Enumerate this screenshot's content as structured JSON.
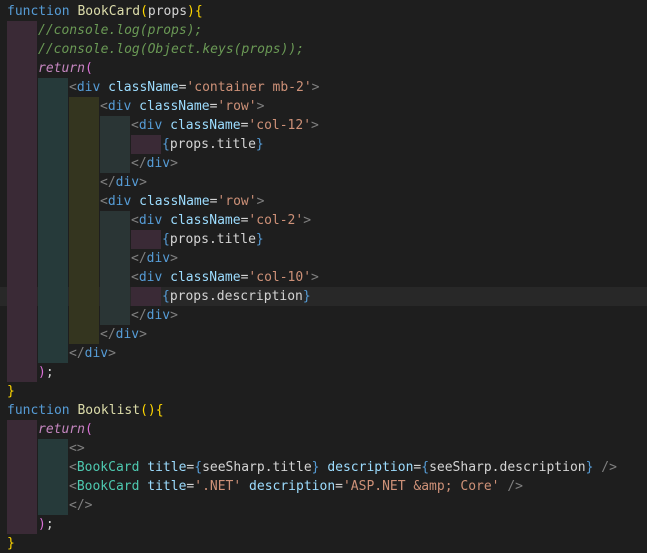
{
  "editor": {
    "language": "javascript-jsx",
    "lines": [
      {
        "indent": 0,
        "tokens": [
          [
            "kw",
            "function"
          ],
          [
            "txt",
            " "
          ],
          [
            "fn",
            "BookCard"
          ],
          [
            "br",
            "("
          ],
          [
            "txt",
            "props"
          ],
          [
            "br",
            "){"
          ]
        ]
      },
      {
        "indent": 1,
        "tokens": [
          [
            "com",
            "//console.log(props);"
          ]
        ]
      },
      {
        "indent": 1,
        "tokens": [
          [
            "com",
            "//console.log(Object.keys(props));"
          ]
        ]
      },
      {
        "indent": 1,
        "tokens": [
          [
            "ctl",
            "return"
          ],
          [
            "br2",
            "("
          ]
        ]
      },
      {
        "indent": 2,
        "tokens": [
          [
            "pun",
            "<"
          ],
          [
            "tag",
            "div"
          ],
          [
            "txt",
            " "
          ],
          [
            "attr",
            "className"
          ],
          [
            "txt",
            "="
          ],
          [
            "str",
            "'container mb-2'"
          ],
          [
            "pun",
            ">"
          ]
        ]
      },
      {
        "indent": 3,
        "tokens": [
          [
            "pun",
            "<"
          ],
          [
            "tag",
            "div"
          ],
          [
            "txt",
            " "
          ],
          [
            "attr",
            "className"
          ],
          [
            "txt",
            "="
          ],
          [
            "str",
            "'row'"
          ],
          [
            "pun",
            ">"
          ]
        ]
      },
      {
        "indent": 4,
        "tokens": [
          [
            "pun",
            "<"
          ],
          [
            "tag",
            "div"
          ],
          [
            "txt",
            " "
          ],
          [
            "attr",
            "className"
          ],
          [
            "txt",
            "="
          ],
          [
            "str",
            "'col-12'"
          ],
          [
            "pun",
            ">"
          ]
        ]
      },
      {
        "indent": 5,
        "tokens": [
          [
            "kw",
            "{"
          ],
          [
            "txt",
            "props.title"
          ],
          [
            "kw",
            "}"
          ]
        ]
      },
      {
        "indent": 4,
        "tokens": [
          [
            "pun",
            "</"
          ],
          [
            "tag",
            "div"
          ],
          [
            "pun",
            ">"
          ]
        ]
      },
      {
        "indent": 3,
        "tokens": [
          [
            "pun",
            "</"
          ],
          [
            "tag",
            "div"
          ],
          [
            "pun",
            ">"
          ]
        ]
      },
      {
        "indent": 3,
        "tokens": [
          [
            "pun",
            "<"
          ],
          [
            "tag",
            "div"
          ],
          [
            "txt",
            " "
          ],
          [
            "attr",
            "className"
          ],
          [
            "txt",
            "="
          ],
          [
            "str",
            "'row'"
          ],
          [
            "pun",
            ">"
          ]
        ]
      },
      {
        "indent": 4,
        "tokens": [
          [
            "pun",
            "<"
          ],
          [
            "tag",
            "div"
          ],
          [
            "txt",
            " "
          ],
          [
            "attr",
            "className"
          ],
          [
            "txt",
            "="
          ],
          [
            "str",
            "'col-2'"
          ],
          [
            "pun",
            ">"
          ]
        ]
      },
      {
        "indent": 5,
        "tokens": [
          [
            "kw",
            "{"
          ],
          [
            "txt",
            "props.title"
          ],
          [
            "kw",
            "}"
          ]
        ]
      },
      {
        "indent": 4,
        "tokens": [
          [
            "pun",
            "</"
          ],
          [
            "tag",
            "div"
          ],
          [
            "pun",
            ">"
          ]
        ]
      },
      {
        "indent": 4,
        "tokens": [
          [
            "pun",
            "<"
          ],
          [
            "tag",
            "div"
          ],
          [
            "txt",
            " "
          ],
          [
            "attr",
            "className"
          ],
          [
            "txt",
            "="
          ],
          [
            "str",
            "'col-10'"
          ],
          [
            "pun",
            ">"
          ]
        ]
      },
      {
        "indent": 5,
        "current": true,
        "tokens": [
          [
            "kw",
            "{"
          ],
          [
            "txt",
            "props.description"
          ],
          [
            "kw",
            "}"
          ]
        ]
      },
      {
        "indent": 4,
        "tokens": [
          [
            "pun",
            "</"
          ],
          [
            "tag",
            "div"
          ],
          [
            "pun",
            ">"
          ]
        ]
      },
      {
        "indent": 3,
        "tokens": [
          [
            "pun",
            "</"
          ],
          [
            "tag",
            "div"
          ],
          [
            "pun",
            ">"
          ]
        ]
      },
      {
        "indent": 2,
        "tokens": [
          [
            "pun",
            "</"
          ],
          [
            "tag",
            "div"
          ],
          [
            "pun",
            ">"
          ]
        ]
      },
      {
        "indent": 1,
        "tokens": [
          [
            "br2",
            ")"
          ],
          [
            "txt",
            ";"
          ]
        ]
      },
      {
        "indent": 0,
        "tokens": [
          [
            "br",
            "}"
          ]
        ]
      },
      {
        "indent": 0,
        "tokens": [
          [
            "kw",
            "function"
          ],
          [
            "txt",
            " "
          ],
          [
            "fn",
            "Booklist"
          ],
          [
            "br",
            "(){"
          ]
        ]
      },
      {
        "indent": 1,
        "tokens": [
          [
            "ctl",
            "return"
          ],
          [
            "br2",
            "("
          ]
        ]
      },
      {
        "indent": 2,
        "tokens": [
          [
            "pun",
            "<>"
          ]
        ]
      },
      {
        "indent": 2,
        "tokens": [
          [
            "pun",
            "<"
          ],
          [
            "comp",
            "BookCard"
          ],
          [
            "txt",
            " "
          ],
          [
            "attr",
            "title"
          ],
          [
            "txt",
            "="
          ],
          [
            "kw",
            "{"
          ],
          [
            "txt",
            "seeSharp.title"
          ],
          [
            "kw",
            "}"
          ],
          [
            "txt",
            " "
          ],
          [
            "attr",
            "description"
          ],
          [
            "txt",
            "="
          ],
          [
            "kw",
            "{"
          ],
          [
            "txt",
            "seeSharp.description"
          ],
          [
            "kw",
            "}"
          ],
          [
            "txt",
            " "
          ],
          [
            "pun",
            "/>"
          ]
        ]
      },
      {
        "indent": 2,
        "tokens": [
          [
            "pun",
            "<"
          ],
          [
            "comp",
            "BookCard"
          ],
          [
            "txt",
            " "
          ],
          [
            "attr",
            "title"
          ],
          [
            "txt",
            "="
          ],
          [
            "str",
            "'.NET'"
          ],
          [
            "txt",
            " "
          ],
          [
            "attr",
            "description"
          ],
          [
            "txt",
            "="
          ],
          [
            "str",
            "'ASP.NET &amp; Core'"
          ],
          [
            "txt",
            " "
          ],
          [
            "pun",
            "/>"
          ]
        ]
      },
      {
        "indent": 2,
        "tokens": [
          [
            "pun",
            "</>"
          ]
        ]
      },
      {
        "indent": 1,
        "tokens": [
          [
            "br2",
            ")"
          ],
          [
            "txt",
            ";"
          ]
        ]
      },
      {
        "indent": 0,
        "tokens": [
          [
            "br",
            "}"
          ]
        ]
      }
    ],
    "colors": {
      "background": "#1e1e1e",
      "current_line": "#282828",
      "indent_guides": [
        "#3a2a36",
        "#263a3a",
        "#34351f",
        "#2a3535",
        "#3a2a36"
      ]
    }
  }
}
